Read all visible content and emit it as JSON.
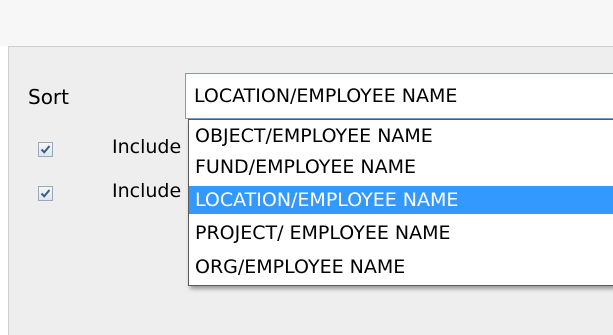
{
  "sort": {
    "label": "Sort",
    "selected_value": "LOCATION/EMPLOYEE NAME",
    "options": [
      {
        "label": "OBJECT/EMPLOYEE NAME",
        "selected": false
      },
      {
        "label": "FUND/EMPLOYEE NAME",
        "selected": false
      },
      {
        "label": "LOCATION/EMPLOYEE NAME",
        "selected": true
      },
      {
        "label": "PROJECT/ EMPLOYEE NAME",
        "selected": false
      },
      {
        "label": "ORG/EMPLOYEE NAME",
        "selected": false
      }
    ]
  },
  "checkboxes": [
    {
      "label": "Include",
      "checked": true
    },
    {
      "label": "Include",
      "checked": true
    }
  ],
  "colors": {
    "selection_bg": "#3399ff",
    "selection_text": "#ffffff",
    "panel_bg": "#eeeeee",
    "check_mark": "#3a5a8c"
  },
  "icons": {
    "check": "check-icon"
  }
}
